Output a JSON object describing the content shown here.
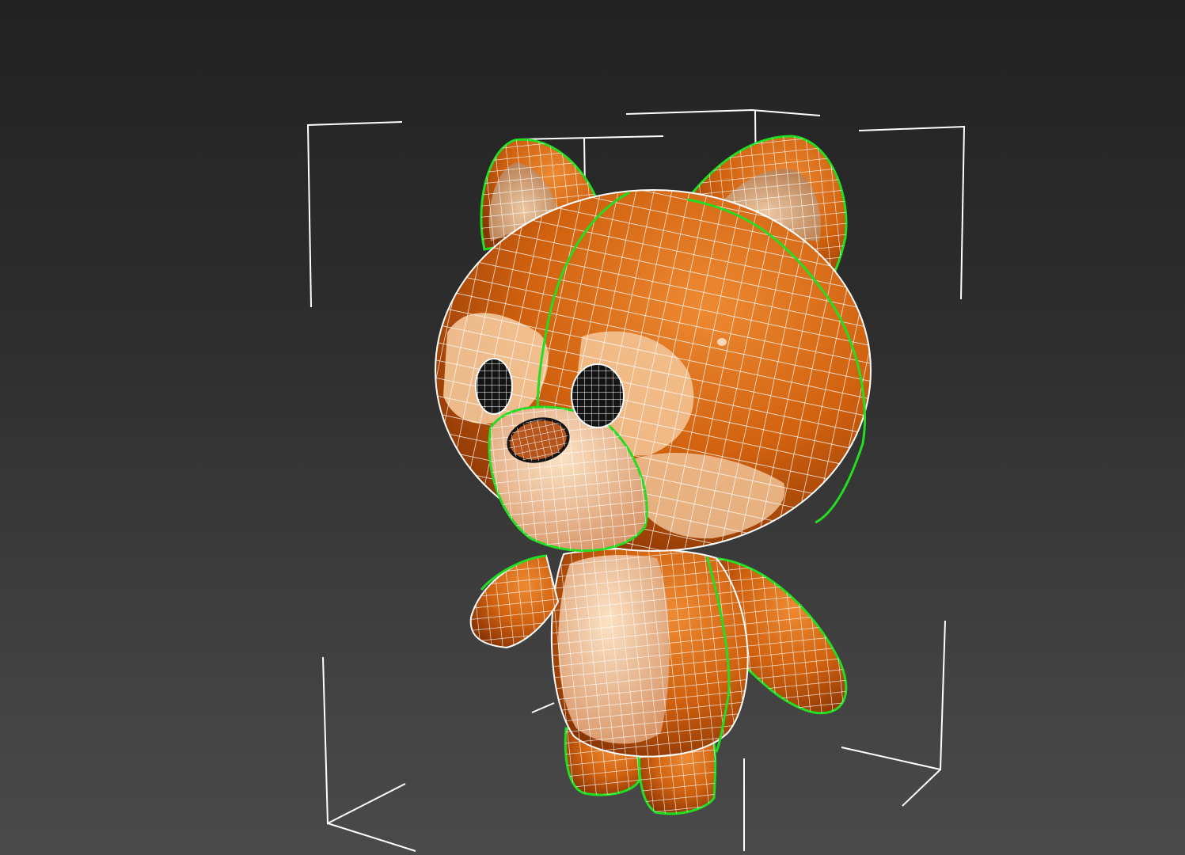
{
  "viewport": {
    "name": "perspective-viewport",
    "background_top": "#222222",
    "background_bottom": "#4a4a4a"
  },
  "selection": {
    "bracket_color": "#ffffff",
    "seam_color": "#22dd22"
  },
  "model": {
    "name": "cartoon-bear-character",
    "fur_color": "#d0610f",
    "fur_dark": "#8a3504",
    "belly_color": "#f4c89a",
    "eye_color": "#141414",
    "wireframe_color": "#ffffff"
  }
}
